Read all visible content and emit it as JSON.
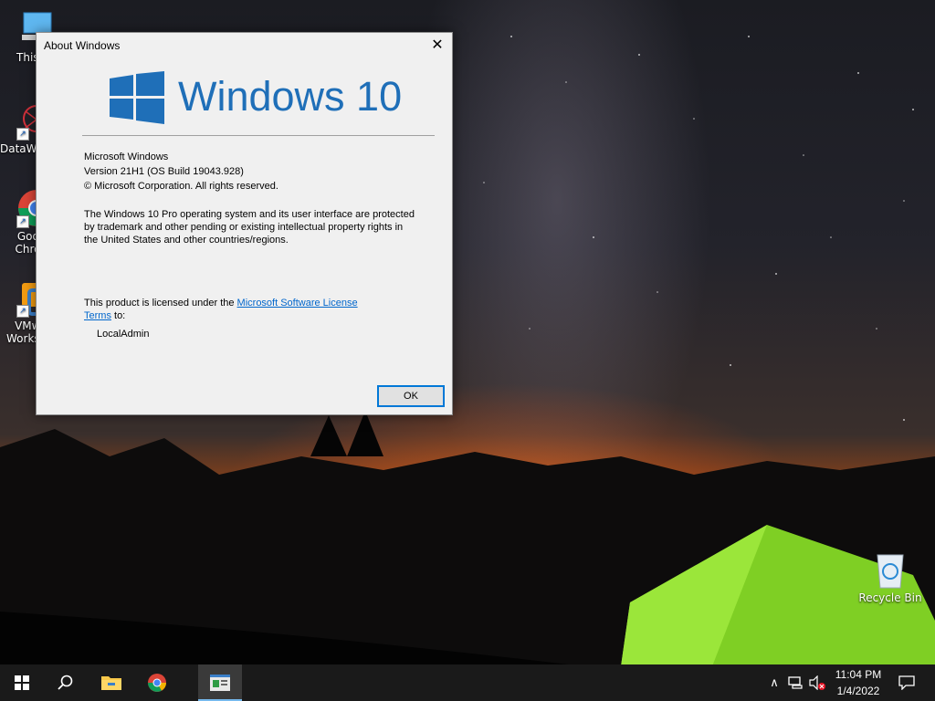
{
  "desktop": {
    "icons": [
      {
        "label": "This PC"
      },
      {
        "label": "DataWagon..."
      },
      {
        "label": "Google Chrome"
      },
      {
        "label": "VMware Workstati..."
      },
      {
        "label": "Recycle Bin"
      }
    ]
  },
  "dialog": {
    "title": "About Windows",
    "brand": "Windows 10",
    "lines": {
      "product": "Microsoft Windows",
      "version": "Version 21H1 (OS Build 19043.928)",
      "copyright": "© Microsoft Corporation. All rights reserved."
    },
    "legal": [
      "The Windows 10 Pro operating system and its user interface are protected",
      "by trademark and other pending or existing intellectual property rights in",
      "the United States and other countries/regions."
    ],
    "license_prefix": "This product is licensed under the ",
    "license_link_1": "Microsoft Software License",
    "license_link_2": "Terms",
    "license_suffix": " to:",
    "licensee": "LocalAdmin",
    "ok_label": "OK"
  },
  "taskbar": {
    "clock_time": "11:04 PM",
    "clock_date": "1/4/2022"
  },
  "colors": {
    "windows_blue": "#1f6fb8",
    "taskbar": "#1a1a1a",
    "focus_blue": "#0078d7"
  }
}
